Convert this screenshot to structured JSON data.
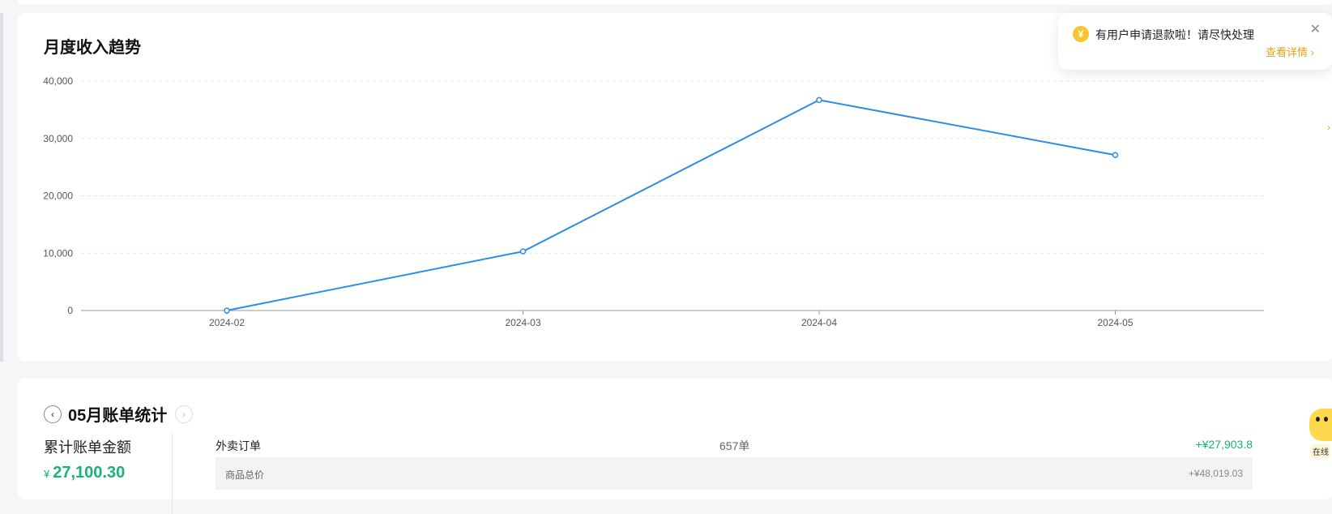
{
  "chart_data": {
    "type": "line",
    "title": "月度收入趋势",
    "categories": [
      "2024-02",
      "2024-03",
      "2024-04",
      "2024-05"
    ],
    "values": [
      0,
      10300,
      36700,
      27100
    ],
    "yticks": [
      "0",
      "10,000",
      "20,000",
      "30,000",
      "40,000"
    ],
    "ylim": [
      0,
      40000
    ],
    "grid": true,
    "color": "#2d8ce6"
  },
  "notification": {
    "icon": "refund-icon",
    "message": "有用户申请退款啦！请尽快处理",
    "link_label": "查看详情",
    "close_glyph": "✕"
  },
  "bill": {
    "title": "05月账单统计",
    "prev_glyph": "‹",
    "next_glyph": "›",
    "total_label": "累计账单金额",
    "currency": "¥",
    "total_value": "27,100.30",
    "rows": [
      {
        "name": "外卖订单",
        "count": "657单",
        "amount": "+¥27,903.8"
      }
    ],
    "sub_rows": [
      {
        "name": "商品总价",
        "amount": "+¥48,019.03"
      }
    ]
  },
  "widgets": {
    "assistant_label": "在线"
  },
  "colors": {
    "accent": "#2d8ce6",
    "income": "#19b27a",
    "warning": "#e0a31d"
  }
}
